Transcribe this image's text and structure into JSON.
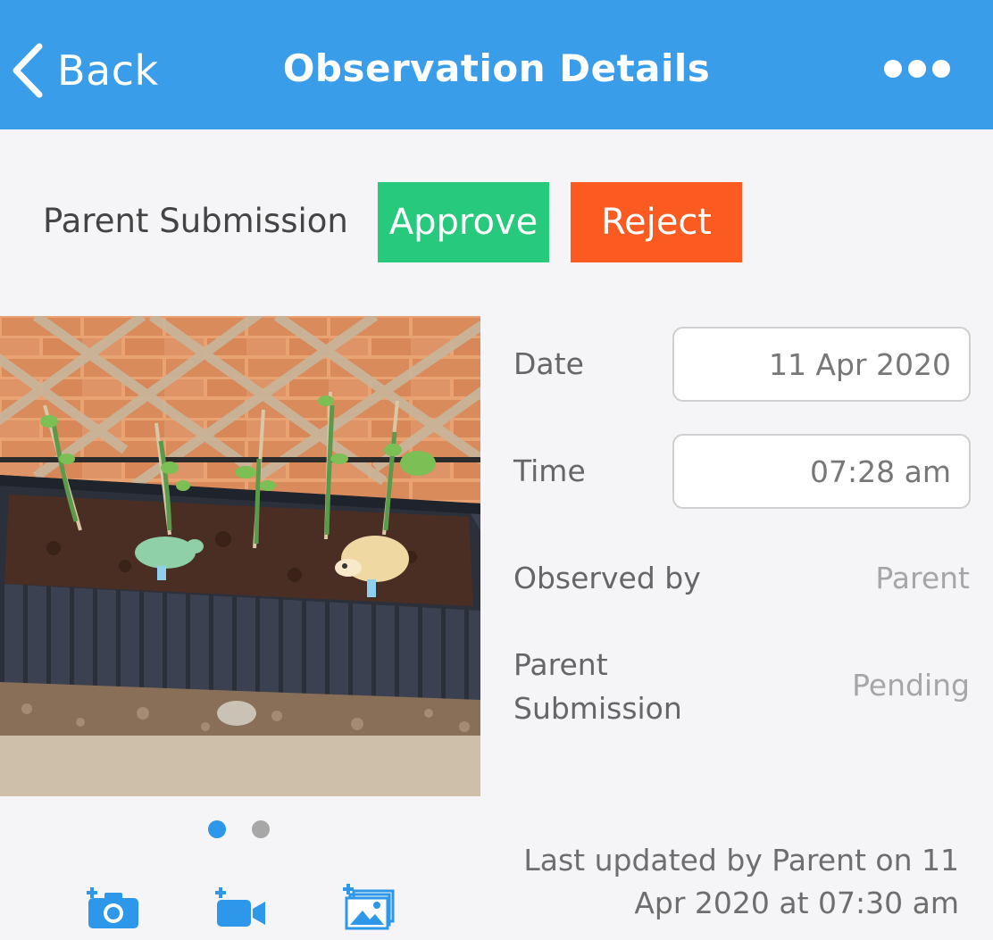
{
  "header": {
    "back_label": "Back",
    "title": "Observation Details",
    "more_icon": "more-horizontal-icon"
  },
  "submission": {
    "label": "Parent Submission",
    "approve_label": "Approve",
    "reject_label": "Reject"
  },
  "gallery": {
    "image": "planter box with seedlings against brick wall",
    "current_page": 1,
    "total_pages": 2
  },
  "details": {
    "date_label": "Date",
    "date_value": "11 Apr 2020",
    "time_label": "Time",
    "time_value": "07:28 am",
    "observed_label": "Observed by",
    "observed_value": "Parent",
    "parent_label_line1": "Parent",
    "parent_label_line2": "Submission",
    "parent_value": "Pending"
  },
  "updated": {
    "line1": "Last updated by Parent on 11",
    "line2": "Apr 2020 at 07:30 am"
  },
  "toolbar": {
    "icons": [
      "add-photo-icon",
      "add-video-icon",
      "add-gallery-icon"
    ]
  },
  "colors": {
    "header": "#399de9",
    "approve": "#27ca7c",
    "reject": "#fb5a20",
    "accent": "#2d98ea",
    "background": "#f5f5f8"
  }
}
